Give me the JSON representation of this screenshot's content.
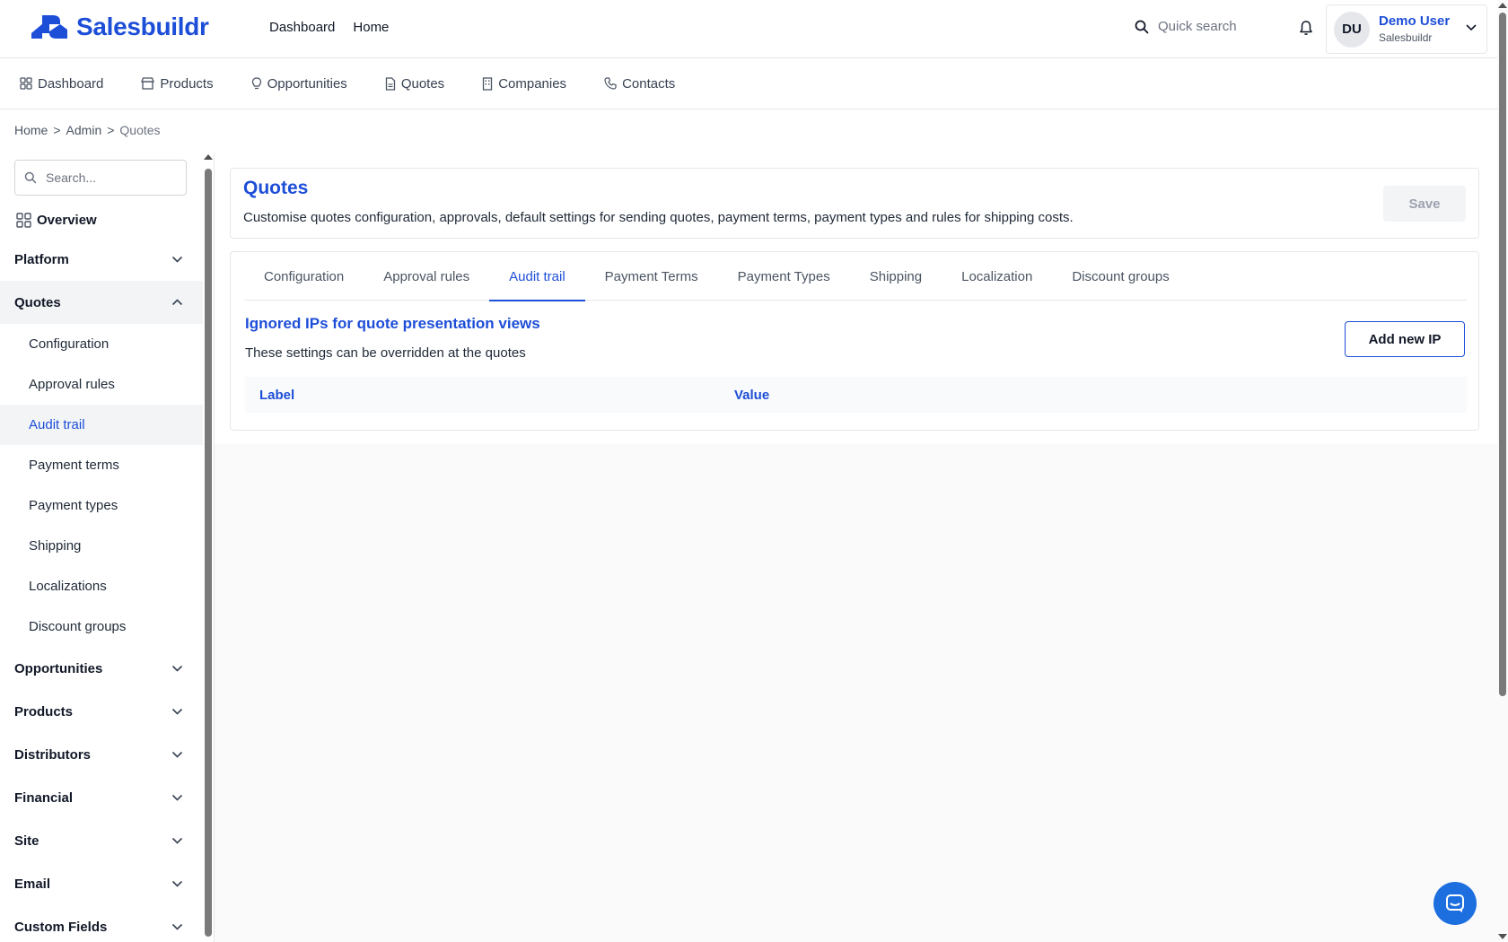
{
  "brand": {
    "name": "Salesbuildr",
    "accent": "#1d4ed8"
  },
  "topnav": [
    "Dashboard",
    "Home"
  ],
  "search": {
    "placeholder": "Quick search",
    "icon": "search-icon"
  },
  "user": {
    "initials": "DU",
    "name": "Demo User",
    "org": "Salesbuildr"
  },
  "subnav": [
    {
      "label": "Dashboard",
      "icon": "grid-icon"
    },
    {
      "label": "Products",
      "icon": "store-icon"
    },
    {
      "label": "Opportunities",
      "icon": "lightbulb-icon"
    },
    {
      "label": "Quotes",
      "icon": "document-icon"
    },
    {
      "label": "Companies",
      "icon": "building-icon"
    },
    {
      "label": "Contacts",
      "icon": "phone-icon"
    }
  ],
  "breadcrumb": [
    "Home",
    ">",
    "Admin",
    ">",
    "Quotes"
  ],
  "sidebar": {
    "search_placeholder": "Search...",
    "overview": "Overview",
    "groups": {
      "platform": "Platform",
      "quotes": "Quotes",
      "opportunities": "Opportunities",
      "products": "Products",
      "distributors": "Distributors",
      "financial": "Financial",
      "site": "Site",
      "email": "Email",
      "custom_fields": "Custom Fields"
    },
    "quotes_items": [
      "Configuration",
      "Approval rules",
      "Audit trail",
      "Payment terms",
      "Payment types",
      "Shipping",
      "Localizations",
      "Discount groups"
    ],
    "active_item": "Audit trail"
  },
  "page": {
    "title": "Quotes",
    "description": "Customise quotes configuration, approvals, default settings for sending quotes, payment terms, payment types and rules for shipping costs.",
    "save_label": "Save"
  },
  "tabs": [
    "Configuration",
    "Approval rules",
    "Audit trail",
    "Payment Terms",
    "Payment Types",
    "Shipping",
    "Localization",
    "Discount groups"
  ],
  "active_tab": "Audit trail",
  "section": {
    "title": "Ignored IPs for quote presentation views",
    "description": "These settings can be overridden at the quotes",
    "add_label": "Add new IP",
    "columns": [
      "Label",
      "Value"
    ]
  }
}
